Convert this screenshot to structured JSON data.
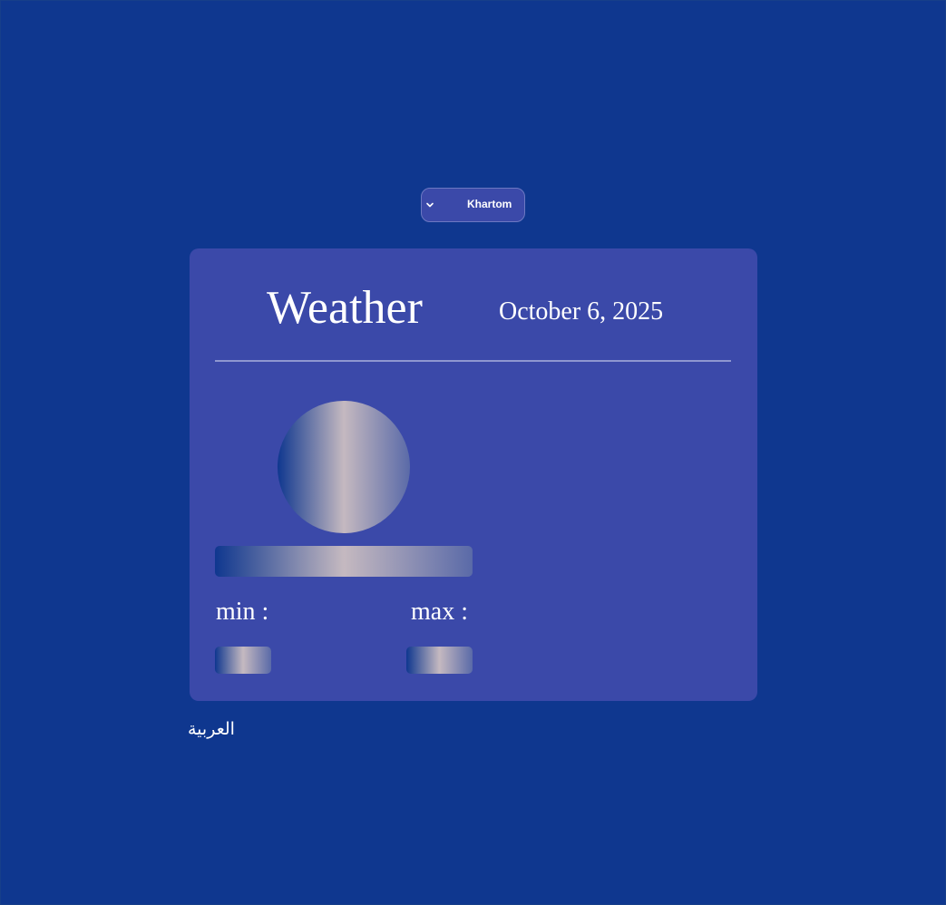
{
  "city_select": {
    "selected": "Khartom",
    "icon": "chevron-down-icon"
  },
  "weather_card": {
    "title": "Weather",
    "date": "October 6, 2025",
    "min_label": "min :",
    "max_label": "max :",
    "loading_placeholders": [
      "weather-icon",
      "description",
      "min-value",
      "max-value"
    ]
  },
  "language_link": {
    "label": "العربية"
  },
  "colors": {
    "background": "#0f378f",
    "card": "#3b49a9",
    "divider": "#8e97d0",
    "skeleton_highlight": "#c5b9c0",
    "text": "#ffffff"
  }
}
